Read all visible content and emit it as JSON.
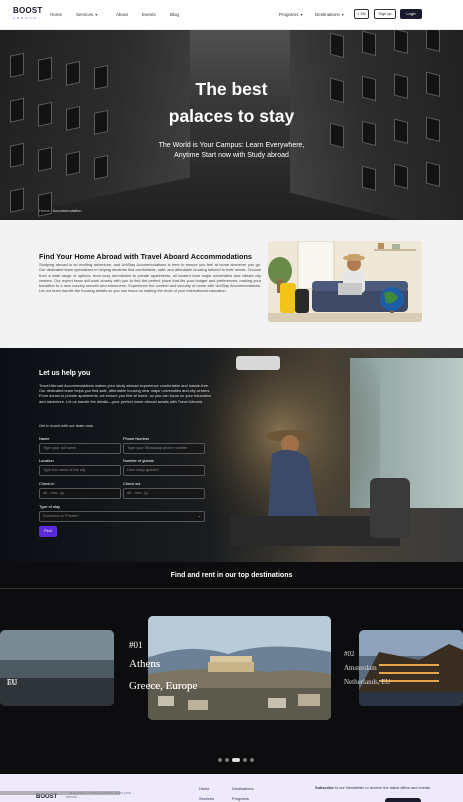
{
  "header": {
    "logo_main": "BOOST",
    "logo_sub": "ABROAD",
    "nav_left": [
      {
        "label": "Home",
        "has_chevron": false
      },
      {
        "label": "Services",
        "has_chevron": true
      },
      {
        "label": "About",
        "has_chevron": false
      },
      {
        "label": "Events",
        "has_chevron": false
      },
      {
        "label": "Blog",
        "has_chevron": false
      }
    ],
    "nav_right": [
      {
        "label": "Programs",
        "has_chevron": true
      },
      {
        "label": "Destinations",
        "has_chevron": true
      }
    ],
    "language": "EN",
    "signup": "Sign up",
    "login": "Login"
  },
  "hero": {
    "title_line1": "The best",
    "title_line2": "palaces to stay",
    "subtitle_line1": "The World is Your Campus: Learn Everywhere,",
    "subtitle_line2": "Anytime Start now with Study abroad",
    "breadcrumb_home": "Home",
    "breadcrumb_sep": "/",
    "breadcrumb_current": "Accommodation"
  },
  "about": {
    "title": "Find Your Home Abroad with Travel Aboard Accommodations",
    "paragraph": "Studying abroad is an exciting adventure, and UniStay Accommodations is here to ensure you feel at home wherever you go. Our dedicated team specializes in helping students find comfortable, safe, and affordable housing tailored to their needs. Choose from a wide range of options, from cozy dormitories to private apartments, all located near major universities and vibrant city centers. Our expert team will work closely with you to find the perfect place that fits your budget and preferences, making your transition to a new country smooth and stress-free. Experience the comfort and security of home with UniStay Accommodations. Let our team handle the housing details so you can focus on making the most of your international education."
  },
  "help": {
    "title": "Let us help you",
    "paragraph": "Travel Abroad Accommodations makes your study abroad experience comfortable and hassle-free. Our dedicated team helps you find safe, affordable housing near major universities and city centers. From dorms to private apartments, we ensure you feel at home, so you can focus on your education and adventure. Let us handle the details—your perfect home abroad awaits with Travel Abroad.",
    "cta": "Get in touch with our team now.",
    "form": {
      "name_label": "Name",
      "name_placeholder": "Type your full name",
      "phone_label": "Phone Number",
      "phone_placeholder": "Type your Whatsapp phone number",
      "location_label": "Location",
      "location_placeholder": "Type the name of the city",
      "guests_label": "Number of guests",
      "guests_placeholder": "How many guests?",
      "checkin_label": "Check-in",
      "checkin_placeholder": "dd - mm - yy",
      "checkout_label": "Check out",
      "checkout_placeholder": "dd - mm - yy",
      "stay_label": "Type of stay",
      "stay_value": "Dormitory or Private?",
      "submit": "Find"
    }
  },
  "destinations": {
    "title": "Find and rent in our top destinations",
    "cards": [
      {
        "num": "",
        "city": "",
        "region": "EU"
      },
      {
        "num": "#01",
        "city": "Athens",
        "region": "Greece, Europe"
      },
      {
        "num": "#02",
        "city": "Amsterdam",
        "region": "Netherlands, EU"
      }
    ],
    "dots": 4,
    "active_dot": 2
  },
  "footer": {
    "logo": "BOOST",
    "blurb": "... is a goal to connect students, share your ... abroad ...",
    "col1": [
      "Home",
      "Services"
    ],
    "col2": [
      "Destinations",
      "Programs"
    ],
    "newsletter_bold": "Subscribe",
    "newsletter_rest": " to our Newsletter to receive the latest offers and events"
  },
  "colors": {
    "accent": "#5b2bd9",
    "dark": "#1b1b2e",
    "footer_bg": "#efeafb"
  }
}
